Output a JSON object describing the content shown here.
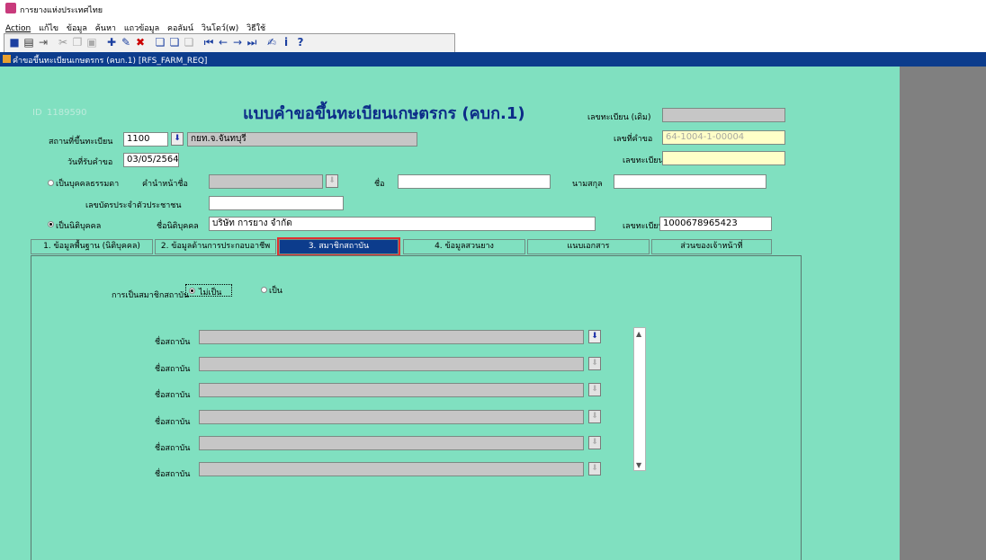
{
  "window": {
    "app_title": "การยางแห่งประเทศไทย",
    "icon": "app-logo-icon"
  },
  "menu": [
    "Action",
    "แก้ไข",
    "ข้อมูล",
    "ค้นหา",
    "แถวข้อมูล",
    "คอลัมน์",
    "วินโดว์(w)",
    "วิธีใช้"
  ],
  "toolbar": {
    "icons": [
      "save-icon",
      "print-icon",
      "exit-icon",
      "cut-icon",
      "copy-icon",
      "paste-icon",
      "insert-record-icon",
      "edit-record-icon",
      "delete-record-icon",
      "query-icon",
      "execute-query-icon",
      "cancel-query-icon",
      "first-record-icon",
      "previous-record-icon",
      "next-record-icon",
      "last-record-icon",
      "edit-field-icon",
      "info-icon",
      "help-icon"
    ]
  },
  "doc_window": {
    "title": "คำขอขึ้นทะเบียนเกษตรกร (คบก.1) [RFS_FARM_REQ]"
  },
  "form": {
    "id_label": "ID",
    "id_value": "1189590",
    "title": "แบบคำขอขึ้นทะเบียนเกษตรกร (คบก.1)",
    "old_reg_label": "เลขทะเบียน (เดิม)",
    "old_reg_value": "",
    "request_no_label": "เลขที่คำขอ",
    "request_no_value": "64-1004-1-00004",
    "reg_no_label": "เลขทะเบียน",
    "reg_no_value": "",
    "place_label": "สถานที่ขึ้นทะเบียน",
    "place_code": "1100",
    "place_name": "กยท.จ.จันทบุรี",
    "date_label": "วันที่รับคำขอ",
    "date_value": "03/05/2564",
    "person_option": "เป็นบุคคลธรรมดา",
    "prefix_label": "คำนำหน้าชื่อ",
    "prefix_value": "",
    "first_name_label": "ชื่อ",
    "first_name_value": "",
    "last_name_label": "นามสกุล",
    "last_name_value": "",
    "id_card_label": "เลขบัตรประจำตัวประชาชน",
    "id_card_value": "",
    "juristic_option": "เป็นนิติบุคคล",
    "juristic_name_label": "ชื่อนิติบุคคล",
    "juristic_name_value": "บริษัท การยาง จำกัด",
    "juristic_reg_label": "เลขทะเบียน",
    "juristic_reg_value": "1000678965423",
    "selected_type": "juristic"
  },
  "tabs": [
    {
      "label": "1. ข้อมูลพื้นฐาน (นิติบุคคล)",
      "active": false
    },
    {
      "label": "2. ข้อมูลด้านการประกอบอาชีพ",
      "active": false
    },
    {
      "label": "3. สมาชิกสถาบัน",
      "active": true
    },
    {
      "label": "4. ข้อมูลสวนยาง",
      "active": false
    },
    {
      "label": "แนบเอกสาร",
      "active": false
    },
    {
      "label": "ส่วนของเจ้าหน้าที่",
      "active": false
    }
  ],
  "membership": {
    "question": "การเป็นสมาชิกสถาบัน",
    "option_no": "ไม่เป็น",
    "option_yes": "เป็น",
    "selected": "no",
    "institution_label": "ชื่อสถาบัน",
    "rows": [
      "",
      "",
      "",
      "",
      "",
      ""
    ]
  }
}
